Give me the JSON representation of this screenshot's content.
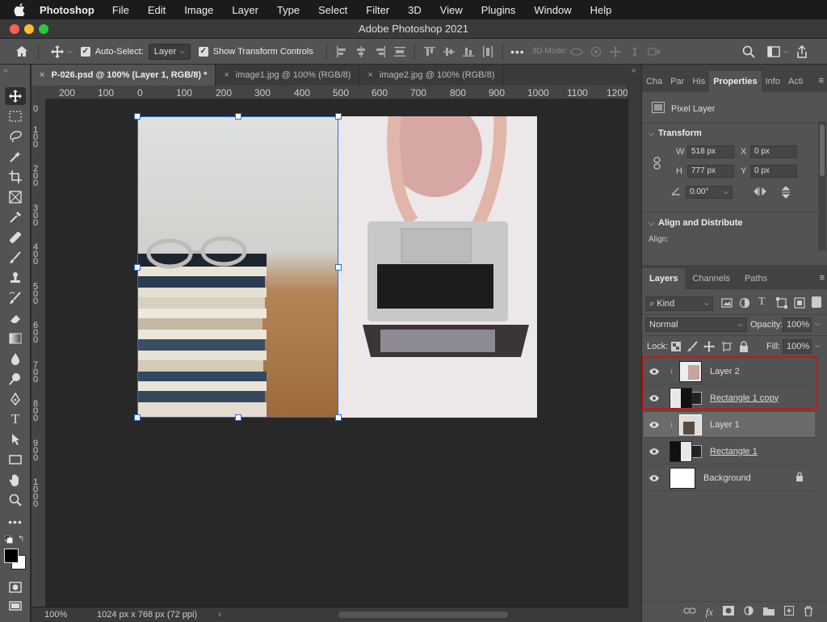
{
  "menubar": {
    "app_name": "Photoshop",
    "items": [
      "File",
      "Edit",
      "Image",
      "Layer",
      "Type",
      "Select",
      "Filter",
      "3D",
      "View",
      "Plugins",
      "Window",
      "Help"
    ]
  },
  "window": {
    "title": "Adobe Photoshop 2021"
  },
  "options": {
    "auto_select_label": "Auto-Select:",
    "auto_select_value": "Layer",
    "show_transform_label": "Show Transform Controls",
    "mode_3d_label": "3D Mode:"
  },
  "tabs": [
    {
      "label": "P-026.psd @ 100% (Layer 1, RGB/8) *",
      "active": true
    },
    {
      "label": "image1.jpg @ 100% (RGB/8)",
      "active": false
    },
    {
      "label": "image2.jpg @ 100% (RGB/8)",
      "active": false
    }
  ],
  "ruler": {
    "h": [
      "200",
      "100",
      "0",
      "100",
      "200",
      "300",
      "400",
      "500",
      "600",
      "700",
      "800",
      "900",
      "1000",
      "1100",
      "1200"
    ],
    "v": [
      "0",
      "1 0 0",
      "2 0 0",
      "3 0 0",
      "4 0 0",
      "5 0 0",
      "6 0 0",
      "7 0 0",
      "8 0 0",
      "9 0 0",
      "1 0 0 0"
    ]
  },
  "status": {
    "zoom": "100%",
    "doc_size": "1024 px x 768 px (72 ppi)"
  },
  "properties": {
    "tabs": [
      "Cha",
      "Par",
      "His",
      "Properties",
      "Info",
      "Acti"
    ],
    "kind": "Pixel Layer",
    "transform_title": "Transform",
    "w_label": "W",
    "w_value": "518 px",
    "h_label": "H",
    "h_value": "777 px",
    "x_label": "X",
    "x_value": "0 px",
    "y_label": "Y",
    "y_value": "0 px",
    "angle_value": "0.00°",
    "align_title": "Align and Distribute",
    "align_label": "Align:"
  },
  "layers_panel": {
    "tabs": [
      "Layers",
      "Channels",
      "Paths"
    ],
    "filter_kind": "Kind",
    "blend_mode": "Normal",
    "opacity_label": "Opacity:",
    "opacity_value": "100%",
    "lock_label": "Lock:",
    "fill_label": "Fill:",
    "fill_value": "100%",
    "layers": [
      {
        "name": "Layer 2",
        "clipped": true,
        "selected": false,
        "underlined": false
      },
      {
        "name": "Rectangle 1 copy",
        "clipped": false,
        "selected": false,
        "underlined": true
      },
      {
        "name": "Layer 1",
        "clipped": true,
        "selected": true,
        "underlined": false
      },
      {
        "name": "Rectangle 1",
        "clipped": false,
        "selected": false,
        "underlined": true
      },
      {
        "name": "Background",
        "clipped": false,
        "selected": false,
        "underlined": false,
        "locked": true
      }
    ]
  },
  "colors": {
    "highlight_box": "#c8151b",
    "selection": "#2e6cd9"
  }
}
